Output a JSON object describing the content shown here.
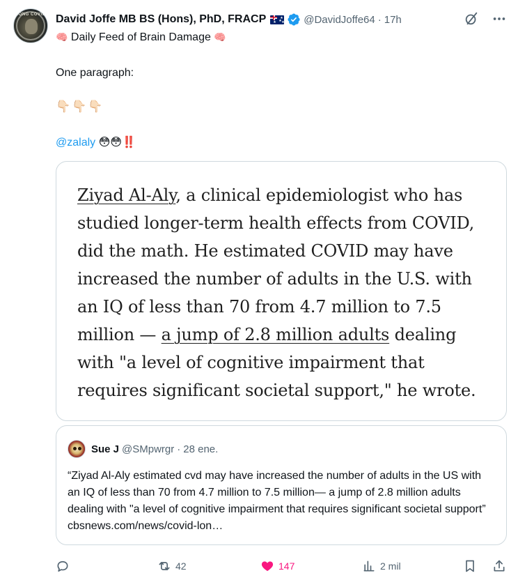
{
  "author": {
    "display_name": "David Joffe MB BS (Hons), PhD, FRACP",
    "handle": "@DavidJoffe64",
    "time": "17h",
    "bio": "Daily Feed of Brain Damage",
    "avatar_text": "LONG COVID"
  },
  "tweet": {
    "line1": "One paragraph:",
    "line2": "👇🏻👇🏻👇🏻",
    "mention": "@zalaly",
    "mention_emojis": "😳😳‼️"
  },
  "image_quote": {
    "name_link": "Ziyad Al-Aly",
    "part1": ", a clinical epidemiologist who has studied longer-term health effects from COVID, did the math. He estimated COVID may have increased the number of adults in the U.S. with an IQ of less than 70 from 4.7 million to 7.5 million — ",
    "underlined": "a jump of 2.8 million adults",
    "part2": " dealing with \"a level of cognitive impairment that requires significant societal support,\" he wrote."
  },
  "quoted_post": {
    "name": "Sue J",
    "handle": "@SMpwrgr",
    "date": "28 ene.",
    "text": "“Ziyad Al-Aly estimated cvd may have increased the number of adults in the US with an IQ of less than 70 from 4.7 million to 7.5 million— a jump of 2.8 million adults dealing with \"a level of cognitive impairment that requires significant societal support” cbsnews.com/news/covid-lon…"
  },
  "actions": {
    "replies": "",
    "reposts": "42",
    "likes": "147",
    "views": "2 mil"
  },
  "colors": {
    "accent": "#1d9bf0",
    "like": "#f91880",
    "muted": "#536471",
    "text": "#0f1419",
    "border": "#cfd9de"
  },
  "icons": [
    "grok-icon",
    "more-icon",
    "verified-icon",
    "reply-icon",
    "repost-icon",
    "like-icon",
    "views-icon",
    "bookmark-icon",
    "share-icon"
  ]
}
